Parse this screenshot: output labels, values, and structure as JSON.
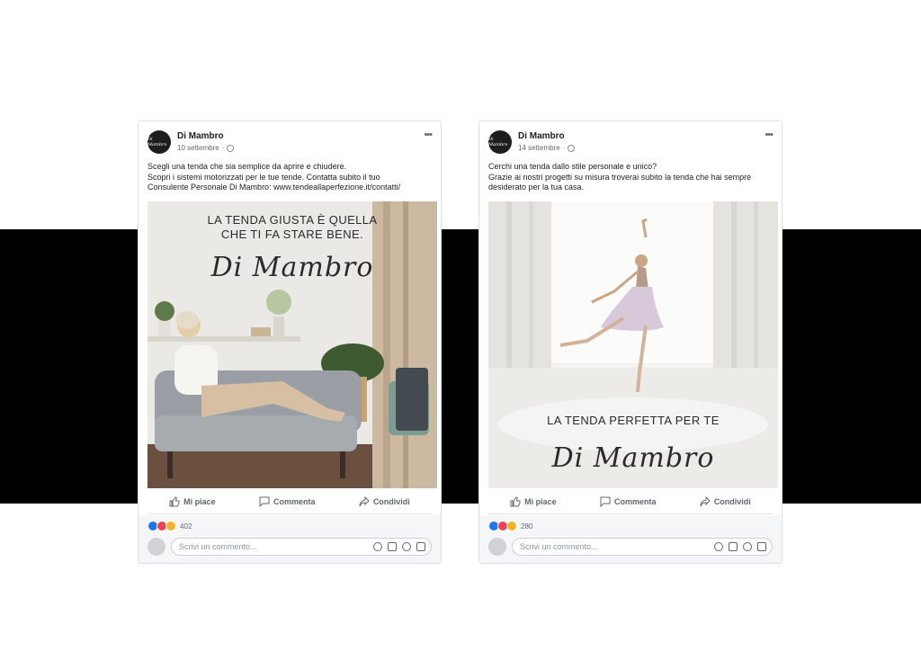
{
  "posts": [
    {
      "page_name": "Di Mambro",
      "avatar_text": "Di Mambro",
      "date": "10 settembre",
      "text_lines": [
        "Scegli una tenda che sia semplice da aprire e chiudere.",
        "Scopri i sistemi motorizzati per le tue tende. Contatta subito il tuo",
        "Consulente Personale Di Mambro: www.tendeallaperfezione.it/contatti/"
      ],
      "image": {
        "headline_lines": [
          "LA TENDA GIUSTA È QUELLA",
          "CHE TI FA STARE BENE."
        ],
        "brand": "Di Mambro"
      },
      "actions": {
        "like": "Mi piace",
        "comment": "Commenta",
        "share": "Condividi"
      },
      "reaction_count": "402",
      "comment_placeholder": "Scrivi un commento..."
    },
    {
      "page_name": "Di Mambro",
      "avatar_text": "Di Mambro",
      "date": "14 settembre",
      "text_lines": [
        "Cerchi una tenda dallo stile personale e unico?",
        "Grazie ai nostri progetti su misura troverai subito la tenda che hai sempre",
        "desiderato per la tua casa."
      ],
      "image": {
        "headline_lines": [
          "LA TENDA PERFETTA PER TE"
        ],
        "brand": "Di Mambro"
      },
      "actions": {
        "like": "Mi piace",
        "comment": "Commenta",
        "share": "Condividi"
      },
      "reaction_count": "280",
      "comment_placeholder": "Scrivi un commento..."
    }
  ],
  "colors": {
    "band": "#000000",
    "facebook_blue": "#1877f2",
    "card_border": "#dddfe2"
  },
  "icons": [
    "more-icon",
    "globe-icon",
    "like-icon",
    "comment-icon",
    "share-icon",
    "emoji-icon",
    "camera-icon",
    "gif-icon",
    "sticker-icon"
  ]
}
